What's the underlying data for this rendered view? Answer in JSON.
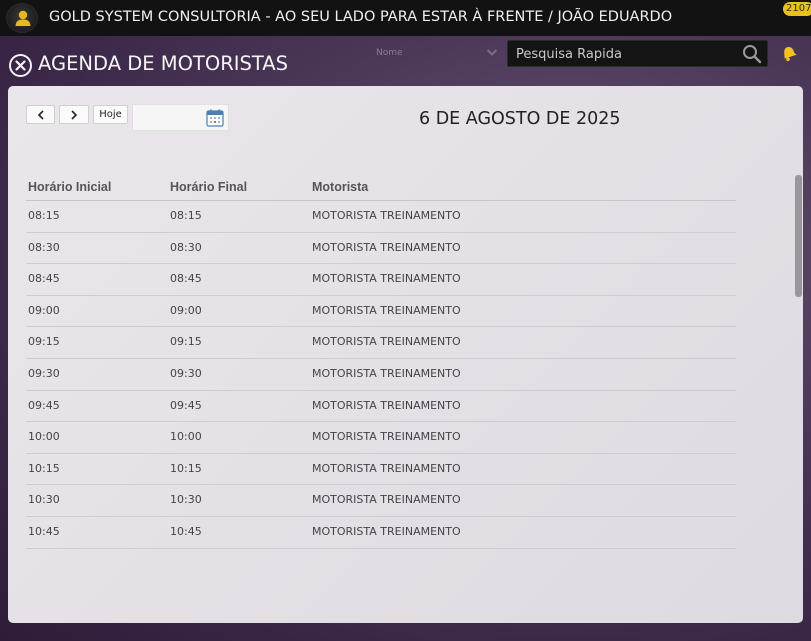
{
  "header": {
    "app_title": "GOLD SYSTEM CONSULTORIA - AO SEU LADO PARA ESTAR À FRENTE / JOÃO EDUARDO",
    "notification_count": "2107",
    "avatar_icon": "user-silhouette-icon"
  },
  "page": {
    "title": "AGENDA DE MOTORISTAS",
    "close_icon": "close-circle-icon"
  },
  "filter": {
    "select_value": "Nome"
  },
  "search": {
    "placeholder": "Pesquisa Rapida"
  },
  "calendar_nav": {
    "prev_label": "<",
    "next_label": ">",
    "today_label": "Hoje",
    "date_value": "",
    "current_date": "6 DE AGOSTO DE 2025"
  },
  "table": {
    "columns": [
      "Horário Inicial",
      "Horário Final",
      "Motorista"
    ],
    "rows": [
      {
        "start": "08:15",
        "end": "08:15",
        "driver": "MOTORISTA TREINAMENTO"
      },
      {
        "start": "08:30",
        "end": "08:30",
        "driver": "MOTORISTA TREINAMENTO"
      },
      {
        "start": "08:45",
        "end": "08:45",
        "driver": "MOTORISTA TREINAMENTO"
      },
      {
        "start": "09:00",
        "end": "09:00",
        "driver": "MOTORISTA TREINAMENTO"
      },
      {
        "start": "09:15",
        "end": "09:15",
        "driver": "MOTORISTA TREINAMENTO"
      },
      {
        "start": "09:30",
        "end": "09:30",
        "driver": "MOTORISTA TREINAMENTO"
      },
      {
        "start": "09:45",
        "end": "09:45",
        "driver": "MOTORISTA TREINAMENTO"
      },
      {
        "start": "10:00",
        "end": "10:00",
        "driver": "MOTORISTA TREINAMENTO"
      },
      {
        "start": "10:15",
        "end": "10:15",
        "driver": "MOTORISTA TREINAMENTO"
      },
      {
        "start": "10:30",
        "end": "10:30",
        "driver": "MOTORISTA TREINAMENTO"
      },
      {
        "start": "10:45",
        "end": "10:45",
        "driver": "MOTORISTA TREINAMENTO"
      }
    ]
  },
  "colors": {
    "topbar": "#121212",
    "accent_gold": "#e8c21c",
    "panel": "#e6e2e8"
  }
}
